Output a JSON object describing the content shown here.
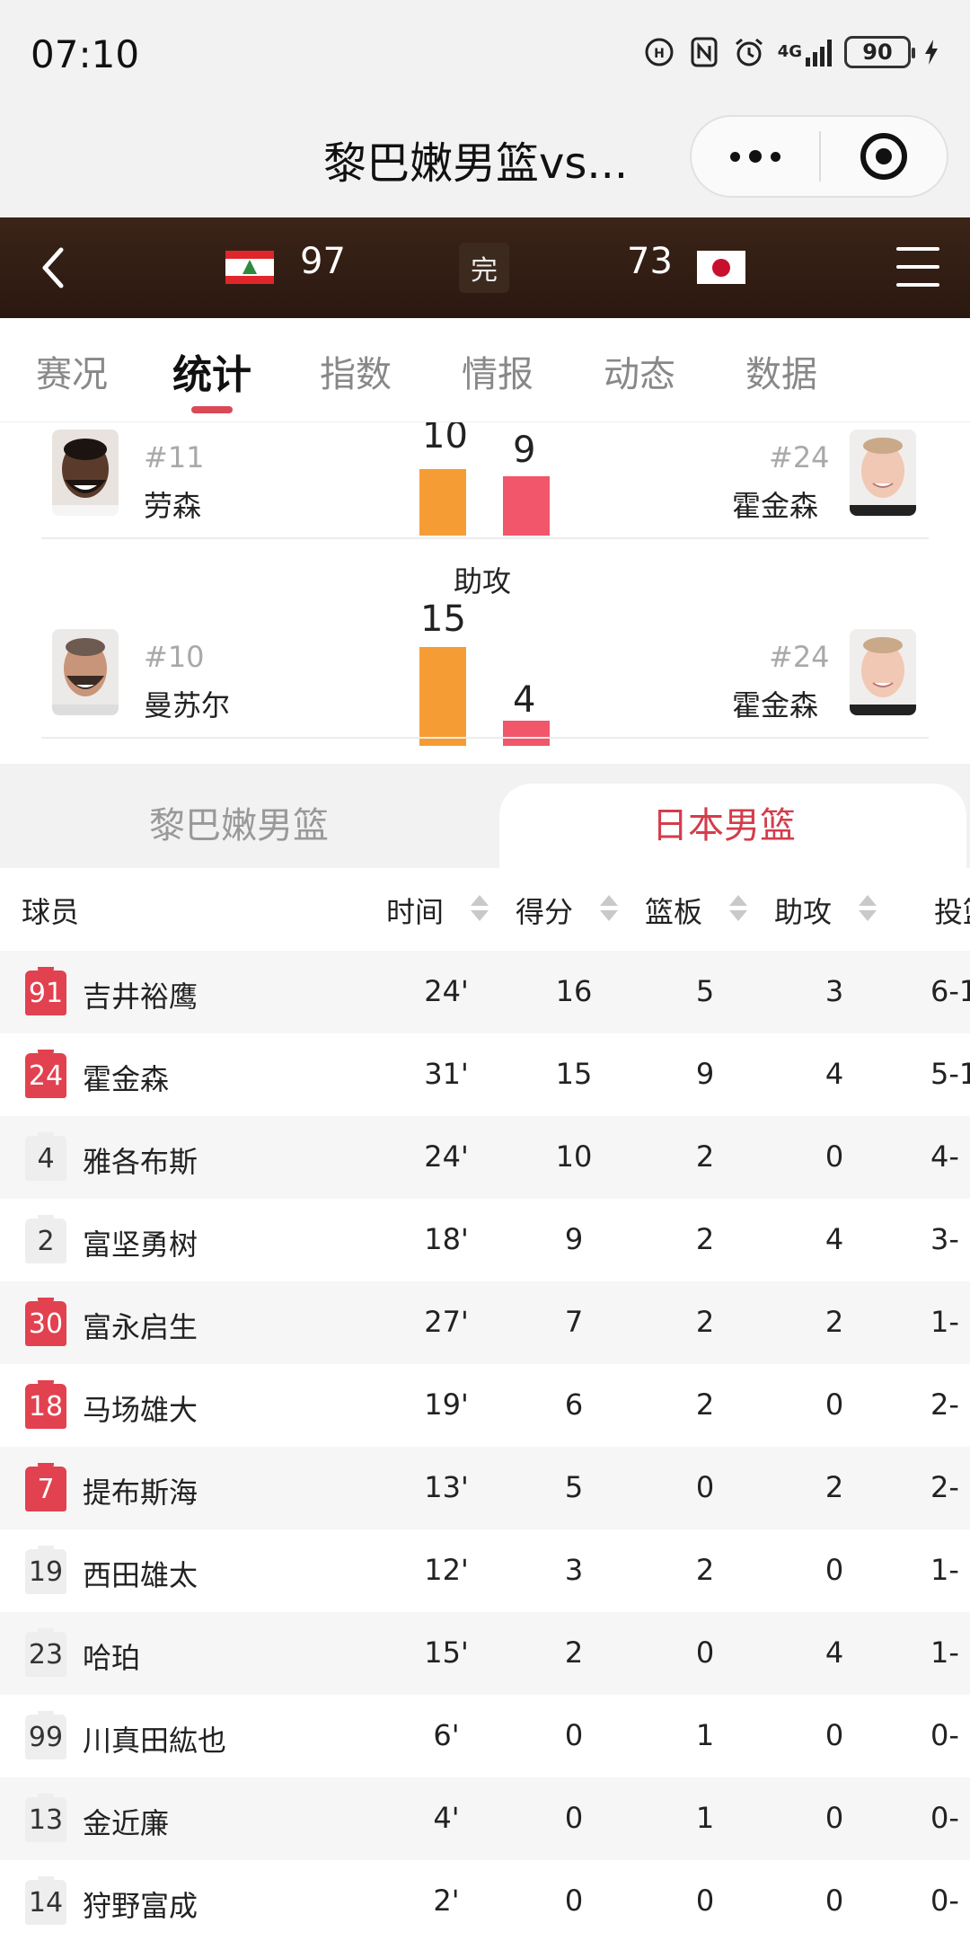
{
  "status_bar": {
    "time": "07:10",
    "icons": [
      "hd-call-icon",
      "nfc-icon",
      "alarm-icon",
      "4g-signal-icon",
      "battery-icon",
      "charging-icon"
    ],
    "network_label": "4G",
    "battery": "90"
  },
  "title_bar": {
    "title": "黎巴嫩男篮vs..."
  },
  "score_header": {
    "home_score": "97",
    "status": "完",
    "away_score": "73"
  },
  "tabs": [
    {
      "label": "赛况"
    },
    {
      "label": "统计"
    },
    {
      "label": "指数"
    },
    {
      "label": "情报"
    },
    {
      "label": "动态"
    },
    {
      "label": "数据"
    }
  ],
  "active_tab": "统计",
  "leaders": [
    {
      "stat": "",
      "home": {
        "number": "#11",
        "name": "劳森",
        "value": "10"
      },
      "away": {
        "number": "#24",
        "name": "霍金森",
        "value": "9"
      }
    },
    {
      "stat": "助攻",
      "home": {
        "number": "#10",
        "name": "曼苏尔",
        "value": "15"
      },
      "away": {
        "number": "#24",
        "name": "霍金森",
        "value": "4"
      }
    }
  ],
  "team_tabs": {
    "home": "黎巴嫩男篮",
    "away": "日本男篮",
    "selected": "日本男篮"
  },
  "table": {
    "headers": {
      "player": "球员",
      "time": "时间",
      "points": "得分",
      "rebounds": "篮板",
      "assists": "助攻",
      "fg": "投篮"
    },
    "rows": [
      {
        "jersey": "91",
        "name": "吉井裕鹰",
        "time": "24'",
        "points": "16",
        "rebounds": "5",
        "assists": "3",
        "fg": "6-1",
        "starter": true
      },
      {
        "jersey": "24",
        "name": "霍金森",
        "time": "31'",
        "points": "15",
        "rebounds": "9",
        "assists": "4",
        "fg": "5-1",
        "starter": true
      },
      {
        "jersey": "4",
        "name": "雅各布斯",
        "time": "24'",
        "points": "10",
        "rebounds": "2",
        "assists": "0",
        "fg": "4-",
        "starter": false
      },
      {
        "jersey": "2",
        "name": "富坚勇树",
        "time": "18'",
        "points": "9",
        "rebounds": "2",
        "assists": "4",
        "fg": "3-",
        "starter": false
      },
      {
        "jersey": "30",
        "name": "富永启生",
        "time": "27'",
        "points": "7",
        "rebounds": "2",
        "assists": "2",
        "fg": "1-",
        "starter": true
      },
      {
        "jersey": "18",
        "name": "马场雄大",
        "time": "19'",
        "points": "6",
        "rebounds": "2",
        "assists": "0",
        "fg": "2-",
        "starter": true
      },
      {
        "jersey": "7",
        "name": "提布斯海",
        "time": "13'",
        "points": "5",
        "rebounds": "0",
        "assists": "2",
        "fg": "2-",
        "starter": true
      },
      {
        "jersey": "19",
        "name": "西田雄太",
        "time": "12'",
        "points": "3",
        "rebounds": "2",
        "assists": "0",
        "fg": "1-",
        "starter": false
      },
      {
        "jersey": "23",
        "name": "哈珀",
        "time": "15'",
        "points": "2",
        "rebounds": "0",
        "assists": "4",
        "fg": "1-",
        "starter": false
      },
      {
        "jersey": "99",
        "name": "川真田紘也",
        "time": "6'",
        "points": "0",
        "rebounds": "1",
        "assists": "0",
        "fg": "0-",
        "starter": false
      },
      {
        "jersey": "13",
        "name": "金近廉",
        "time": "4'",
        "points": "0",
        "rebounds": "1",
        "assists": "0",
        "fg": "0-",
        "starter": false
      },
      {
        "jersey": "14",
        "name": "狩野富成",
        "time": "2'",
        "points": "0",
        "rebounds": "0",
        "assists": "0",
        "fg": "0-",
        "starter": false
      }
    ]
  },
  "colors": {
    "accent_red": "#d33d4c",
    "home_bar": "#f59d34",
    "away_bar": "#f2566a",
    "header_brown": "#2f1c13"
  }
}
